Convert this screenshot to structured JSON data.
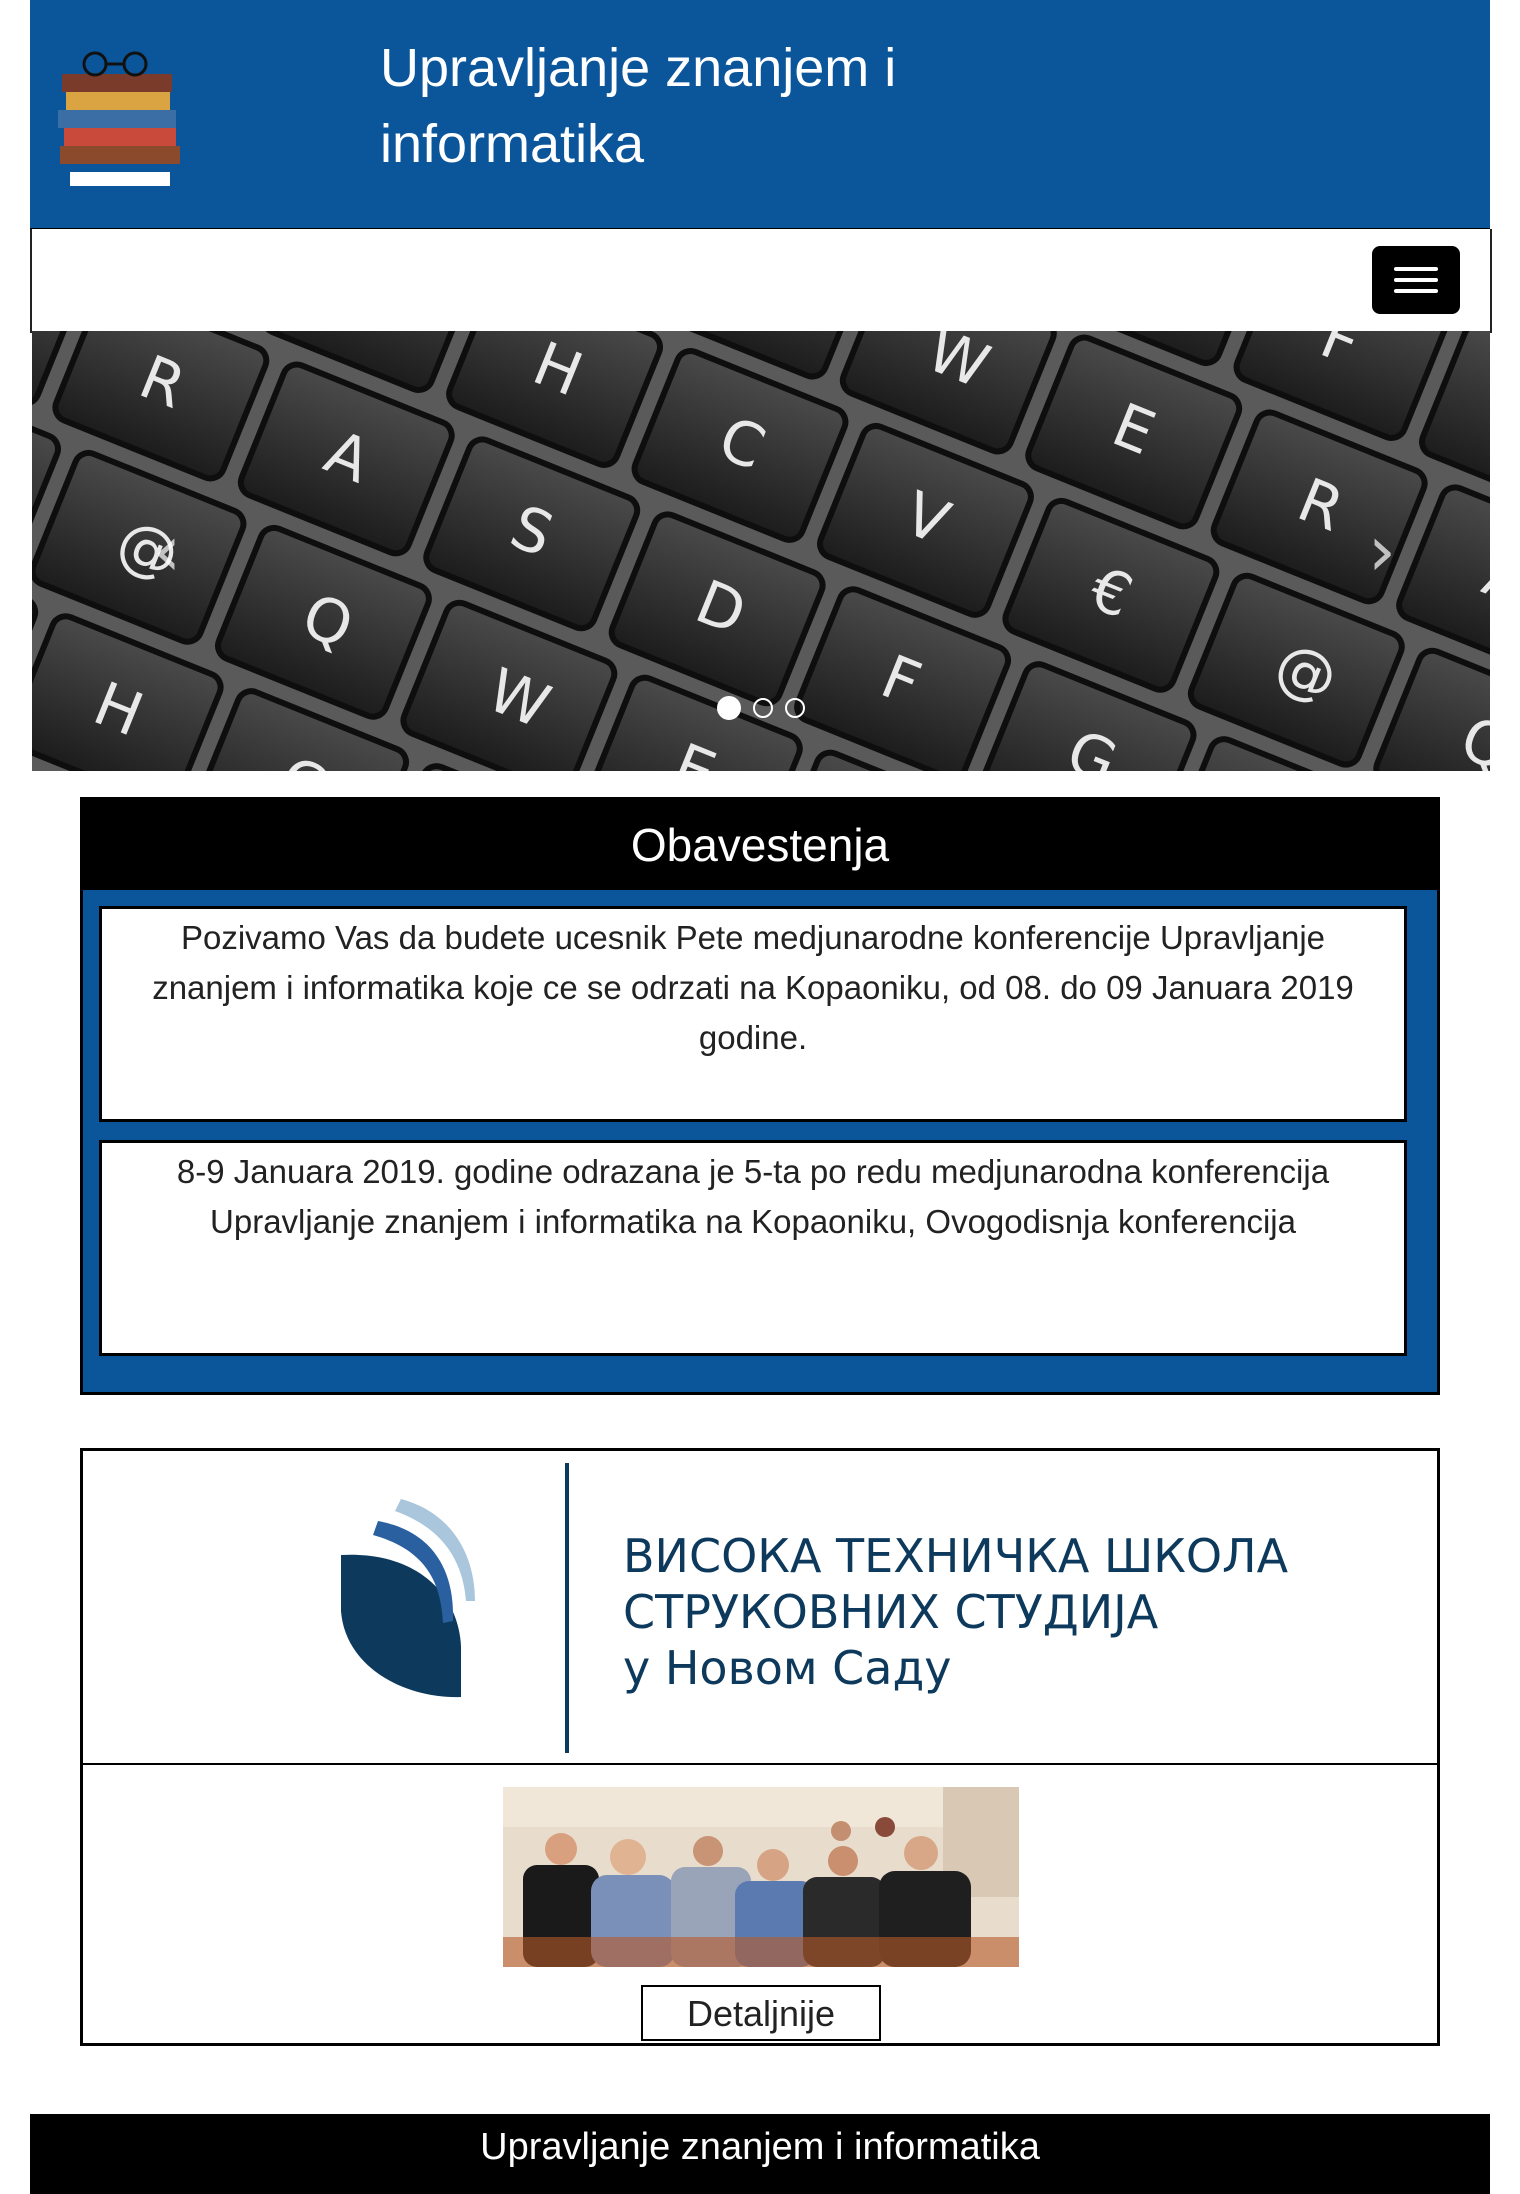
{
  "header": {
    "title": "Upravljanje znanjem i informatika",
    "logo_icon": "books-stack-icon"
  },
  "navbar": {
    "menu_icon": "hamburger-menu-icon"
  },
  "carousel": {
    "prev_glyph": "‹",
    "next_glyph": "›",
    "slides": 3,
    "active_slide": 1,
    "keys": [
      "Q",
      "W",
      "E",
      "R",
      "A",
      "S",
      "D",
      "F",
      "G",
      "H",
      "C",
      "V",
      "€",
      "@"
    ]
  },
  "notices": {
    "title": "Obavestenja",
    "items": [
      "Pozivamo Vas da budete ucesnik Pete medjunarodne konferencije Upravljanje znanjem i informatika koje ce se odrzati na Kopaoniku, od 08. do 09 Januara 2019 godine.",
      "8-9 Januara 2019. godine odrazana je 5-ta po redu medjunarodna konferencija Upravljanje znanjem i informatika na Kopaoniku, Ovogodisnja konferencija"
    ]
  },
  "card": {
    "school_lines": [
      "ВИСОКА ТЕХНИЧКА ШКОЛА",
      "СТРУКОВНИХ СТУДИЈА",
      "у Новом Саду"
    ],
    "details_label": "Detaljnije"
  },
  "footer": {
    "text": "Upravljanje znanjem i informatika"
  },
  "colors": {
    "brand_blue": "#0b559b",
    "black": "#000000",
    "school_navy": "#0d3a5c"
  }
}
